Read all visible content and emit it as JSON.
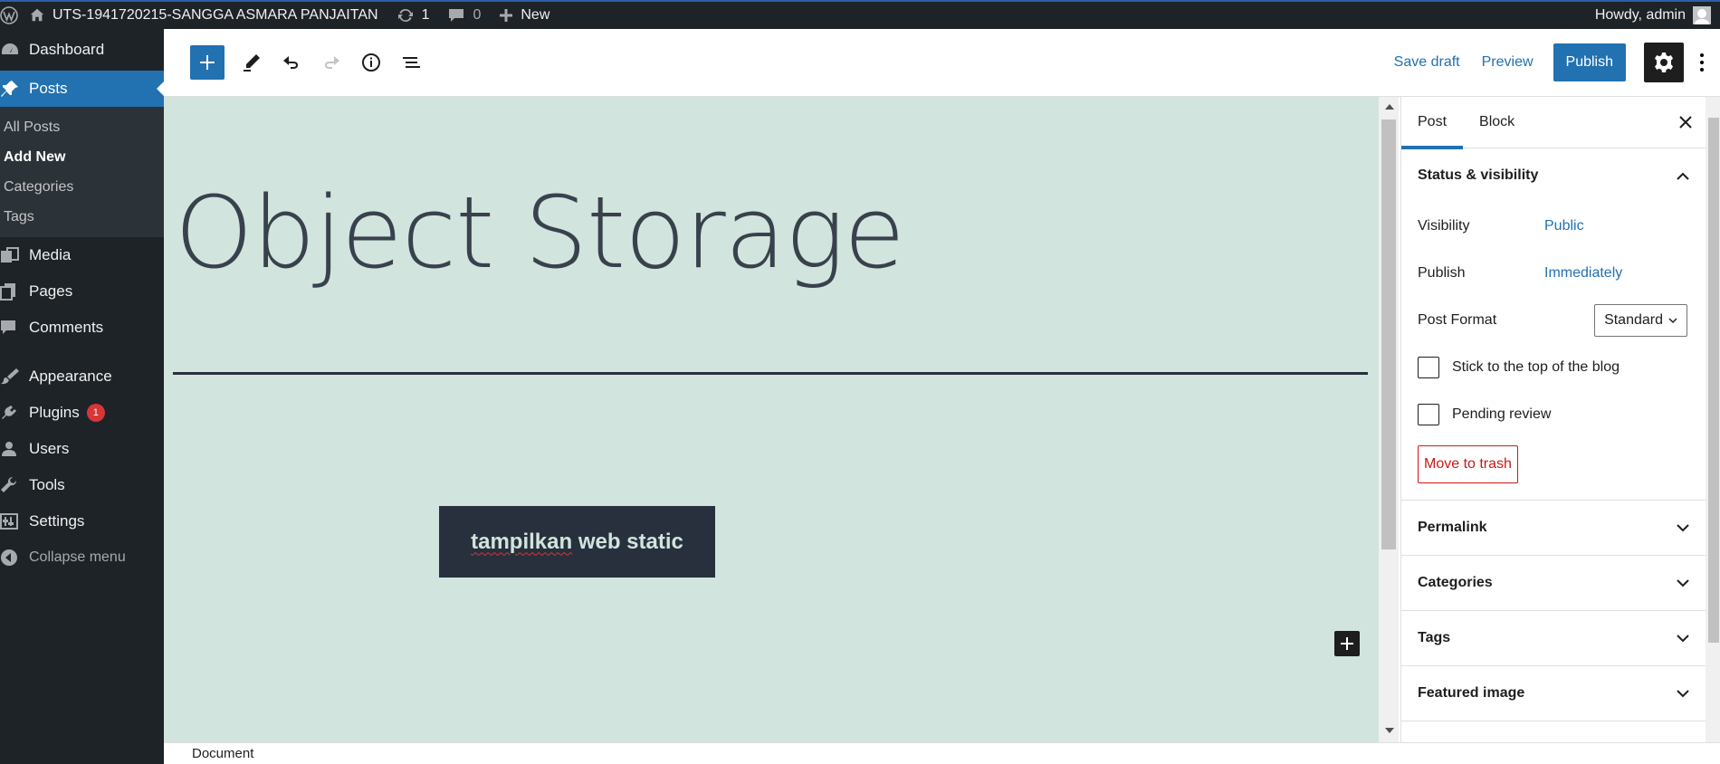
{
  "adminbar": {
    "site_name": "UTS-1941720215-SANGGA ASMARA PANJAITAN",
    "updates_count": "1",
    "comments_count": "0",
    "new_label": "New",
    "howdy": "Howdy, admin"
  },
  "sidebar": {
    "dashboard": "Dashboard",
    "posts": "Posts",
    "sub": {
      "all_posts": "All Posts",
      "add_new": "Add New",
      "categories": "Categories",
      "tags": "Tags"
    },
    "media": "Media",
    "pages": "Pages",
    "comments": "Comments",
    "appearance": "Appearance",
    "plugins": "Plugins",
    "plugins_badge": "1",
    "users": "Users",
    "tools": "Tools",
    "settings": "Settings",
    "collapse": "Collapse menu"
  },
  "header": {
    "save_draft": "Save draft",
    "preview": "Preview",
    "publish": "Publish"
  },
  "canvas": {
    "title": "Object Storage",
    "button_word1": "tampilkan",
    "button_rest": " web static"
  },
  "footer": {
    "breadcrumb": "Document"
  },
  "settings_panel": {
    "tab_post": "Post",
    "tab_block": "Block",
    "status_heading": "Status & visibility",
    "visibility_label": "Visibility",
    "visibility_value": "Public",
    "publish_label": "Publish",
    "publish_value": "Immediately",
    "format_label": "Post Format",
    "format_value": "Standard",
    "stick_label": "Stick to the top of the blog",
    "pending_label": "Pending review",
    "trash_label": "Move to trash",
    "permalink": "Permalink",
    "categories": "Categories",
    "tags": "Tags",
    "featured_image": "Featured image"
  },
  "colors": {
    "admin_dark": "#1d2327",
    "accent": "#2271b1",
    "canvas_bg": "#d1e4dd",
    "danger": "#cc1818"
  }
}
